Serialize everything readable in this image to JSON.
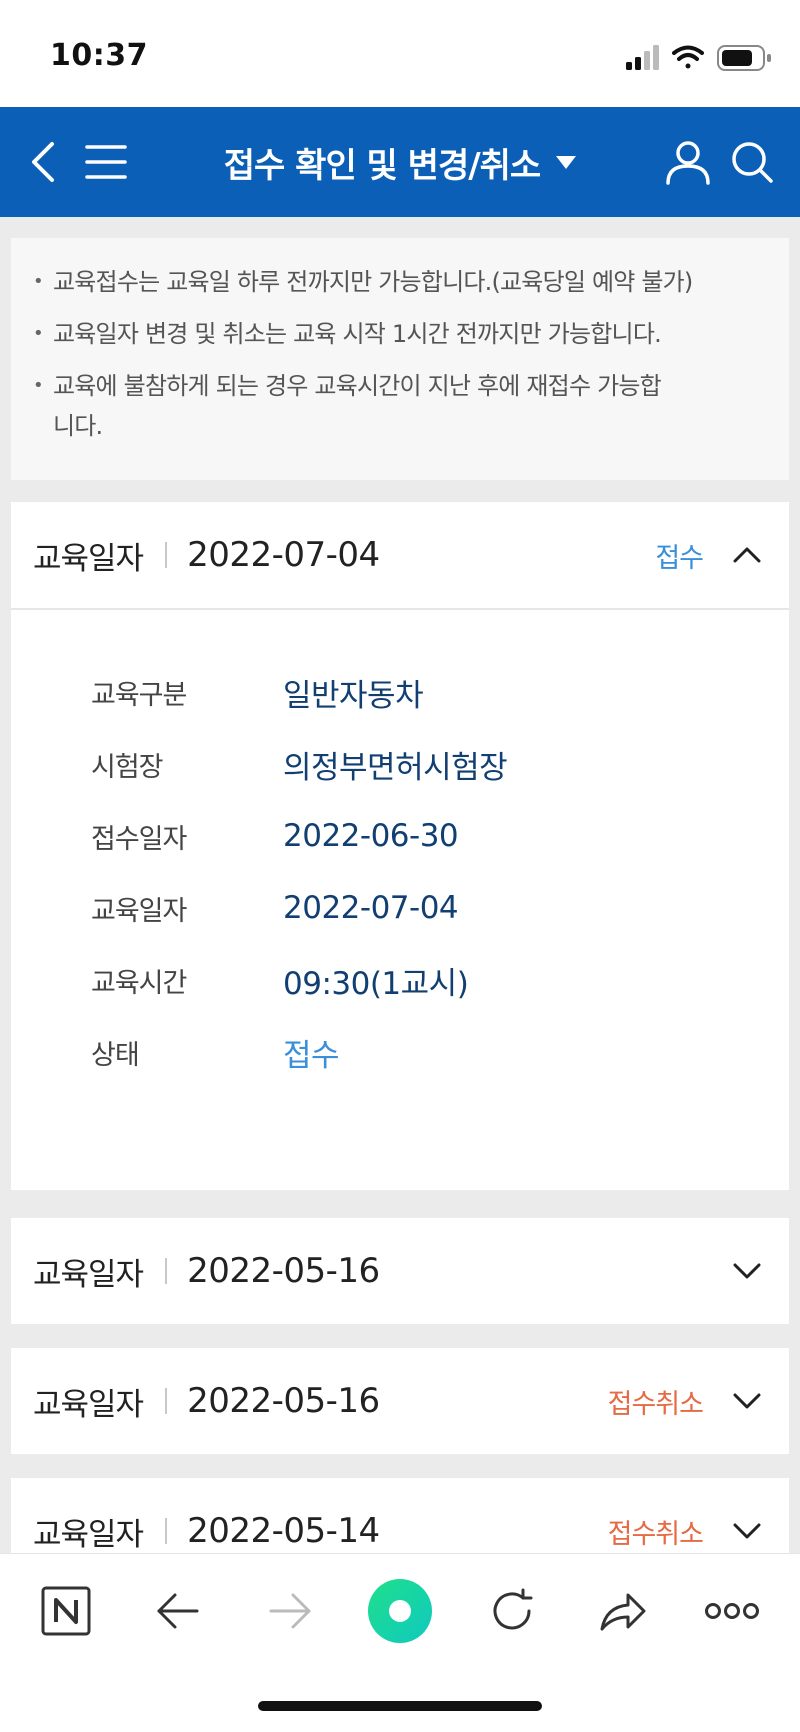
{
  "status_bar": {
    "time": "10:37"
  },
  "header": {
    "title": "접수 확인 및 변경/취소"
  },
  "notices": [
    "교육접수는 교육일 하루 전까지만 가능합니다.(교육당일 예약 불가)",
    "교육일자 변경 및 취소는 교육 시작 1시간 전까지만 가능합니다.",
    "교육에 불참하게 되는 경우 교육시간이 지난 후에 재접수 가능합니다."
  ],
  "cards": [
    {
      "label": "교육일자",
      "date": "2022-07-04",
      "status": "접수",
      "expanded": true,
      "details": [
        {
          "key": "교육구분",
          "value": "일반자동차"
        },
        {
          "key": "시험장",
          "value": "의정부면허시험장"
        },
        {
          "key": "접수일자",
          "value": "2022-06-30"
        },
        {
          "key": "교육일자",
          "value": "2022-07-04"
        },
        {
          "key": "교육시간",
          "value": "09:30(1교시)"
        },
        {
          "key": "상태",
          "value": "접수"
        }
      ]
    },
    {
      "label": "교육일자",
      "date": "2022-05-16",
      "status": "",
      "expanded": false
    },
    {
      "label": "교육일자",
      "date": "2022-05-16",
      "status": "접수취소",
      "expanded": false
    },
    {
      "label": "교육일자",
      "date": "2022-05-14",
      "status": "접수취소",
      "expanded": false
    }
  ],
  "colors": {
    "header_bg": "#0b5fb6",
    "status_received": "#3a8fd9",
    "status_cancelled": "#e66b45",
    "detail_value": "#123f72"
  },
  "toolbar": {
    "icons": [
      "naver-n-icon",
      "back-arrow-icon",
      "forward-arrow-icon",
      "green-dot-icon",
      "refresh-icon",
      "share-icon",
      "more-icon"
    ]
  }
}
